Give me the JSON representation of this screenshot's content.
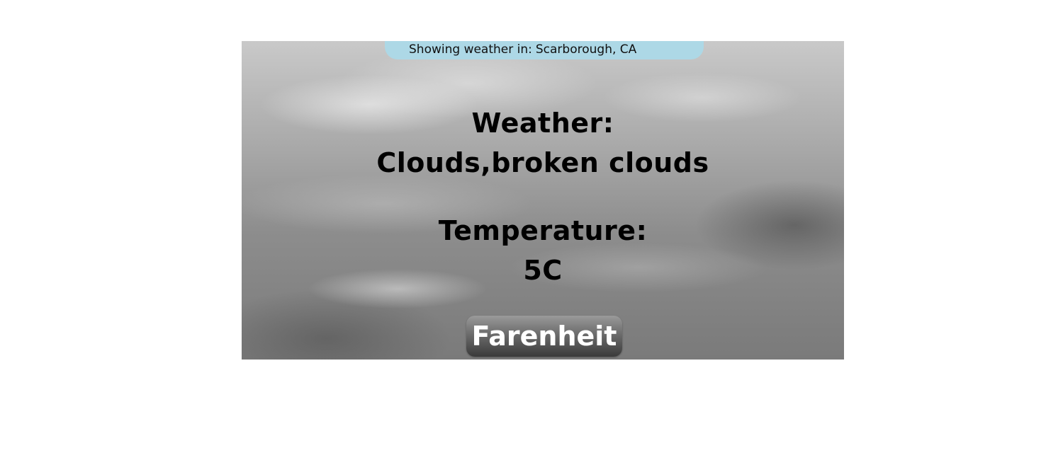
{
  "location": {
    "label": "Showing weather in:",
    "value": "Scarborough, CA"
  },
  "weather": {
    "heading": "Weather:",
    "value": "Clouds,broken clouds"
  },
  "temperature": {
    "heading": "Temperature:",
    "value": "5C"
  },
  "unit_toggle": {
    "label": "Farenheit"
  },
  "colors": {
    "location_pill": "#add8e6",
    "text": "#000000",
    "button_text": "#ffffff"
  },
  "background": {
    "image": "cloudy-sky",
    "tone": "grayscale"
  }
}
